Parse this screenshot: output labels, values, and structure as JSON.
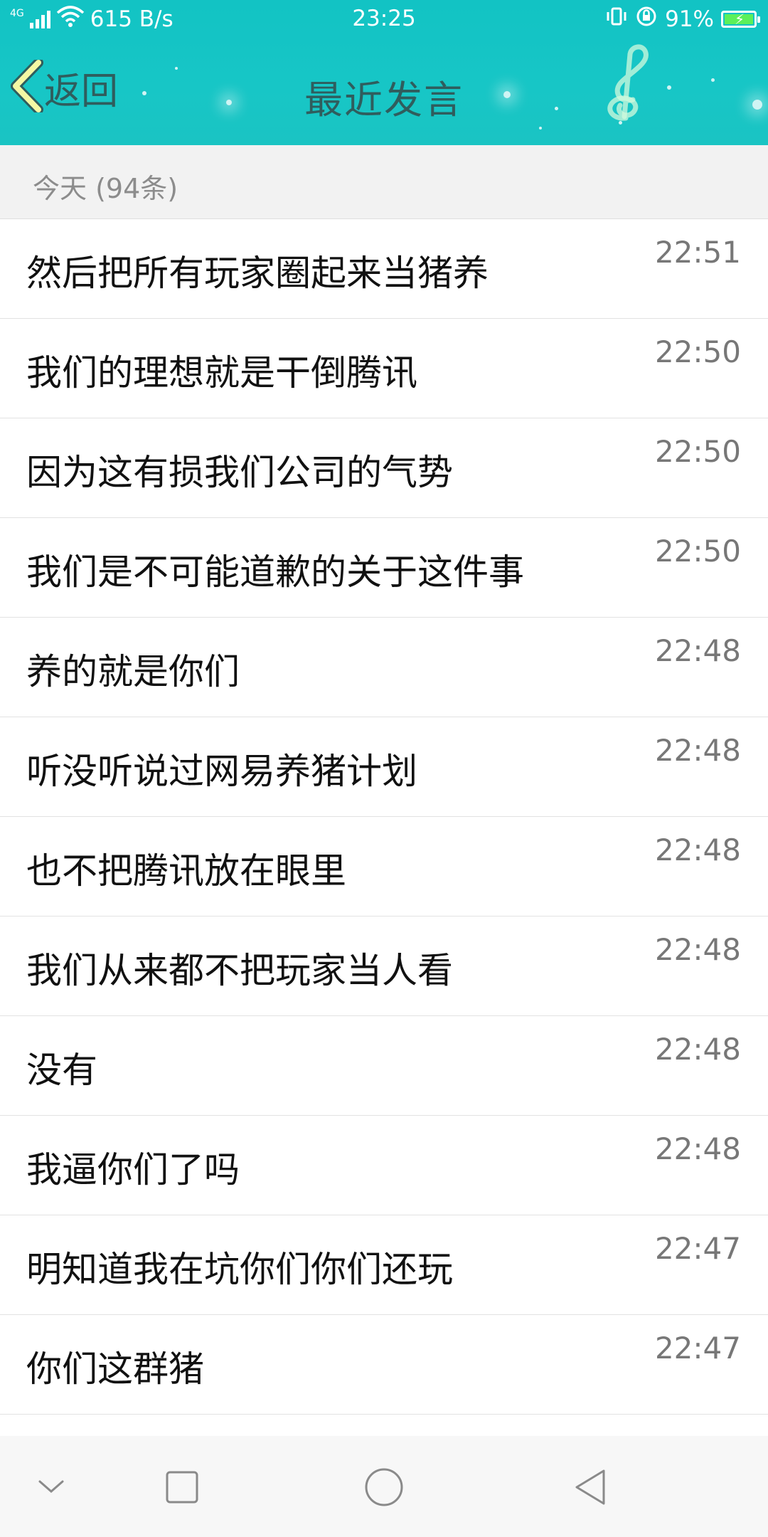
{
  "status_bar": {
    "network_type": "4G",
    "speed": "615 B/s",
    "time": "23:25",
    "battery": "91%",
    "battery_level": 0.91,
    "icons": [
      "signal-icon",
      "wifi-icon",
      "vibrate-icon",
      "rotation-lock-icon",
      "battery-charging-icon"
    ]
  },
  "header": {
    "back_label": "返回",
    "title": "最近发言",
    "background_color": "#17c6c6",
    "title_color": "#2f5d5d"
  },
  "section": {
    "label": "今天 (94条)"
  },
  "messages": [
    {
      "text": "然后把所有玩家圈起来当猪养",
      "time": "22:51"
    },
    {
      "text": "我们的理想就是干倒腾讯",
      "time": "22:50"
    },
    {
      "text": "因为这有损我们公司的气势",
      "time": "22:50"
    },
    {
      "text": "我们是不可能道歉的关于这件事",
      "time": "22:50"
    },
    {
      "text": "养的就是你们",
      "time": "22:48"
    },
    {
      "text": "听没听说过网易养猪计划",
      "time": "22:48"
    },
    {
      "text": "也不把腾讯放在眼里",
      "time": "22:48"
    },
    {
      "text": "我们从来都不把玩家当人看",
      "time": "22:48"
    },
    {
      "text": "没有",
      "time": "22:48"
    },
    {
      "text": "我逼你们了吗",
      "time": "22:48"
    },
    {
      "text": "明知道我在坑你们你们还玩",
      "time": "22:47"
    },
    {
      "text": "你们这群猪",
      "time": "22:47"
    }
  ],
  "nav_bar": {
    "icons": [
      "chevron-down-icon",
      "recents-icon",
      "home-icon",
      "back-triangle-icon"
    ]
  }
}
